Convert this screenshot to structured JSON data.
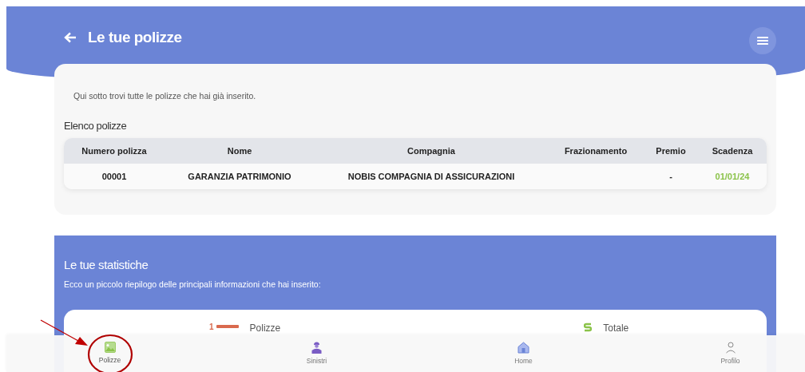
{
  "header": {
    "title": "Le tue polizze"
  },
  "policies": {
    "intro": "Qui sotto trovi tutte le polizze che hai già inserito.",
    "list_title": "Elenco polizze",
    "columns": [
      "Numero polizza",
      "Nome",
      "Compagnia",
      "Frazionamento",
      "Premio",
      "Scadenza"
    ],
    "rows": [
      {
        "cells": [
          "00001",
          "GARANZIA PATRIMONIO",
          "NOBIS COMPAGNIA DI ASSICURAZIONI",
          "",
          "-",
          "01/01/24"
        ]
      }
    ]
  },
  "stats": {
    "title": "Le tue statistiche",
    "subtitle": "Ecco un piccolo riepilogo delle principali informazioni che hai inserito:",
    "items": [
      {
        "kind": "count",
        "badge": "1",
        "label": "Polizze"
      },
      {
        "kind": "money",
        "label": "Totale"
      }
    ]
  },
  "nav": [
    {
      "kind": "image",
      "label": "Polizze",
      "selected": true
    },
    {
      "kind": "worker",
      "label": "Sinistri",
      "selected": false
    },
    {
      "kind": "home",
      "label": "Home",
      "selected": false
    },
    {
      "kind": "user",
      "label": "Profilo",
      "selected": false
    }
  ]
}
